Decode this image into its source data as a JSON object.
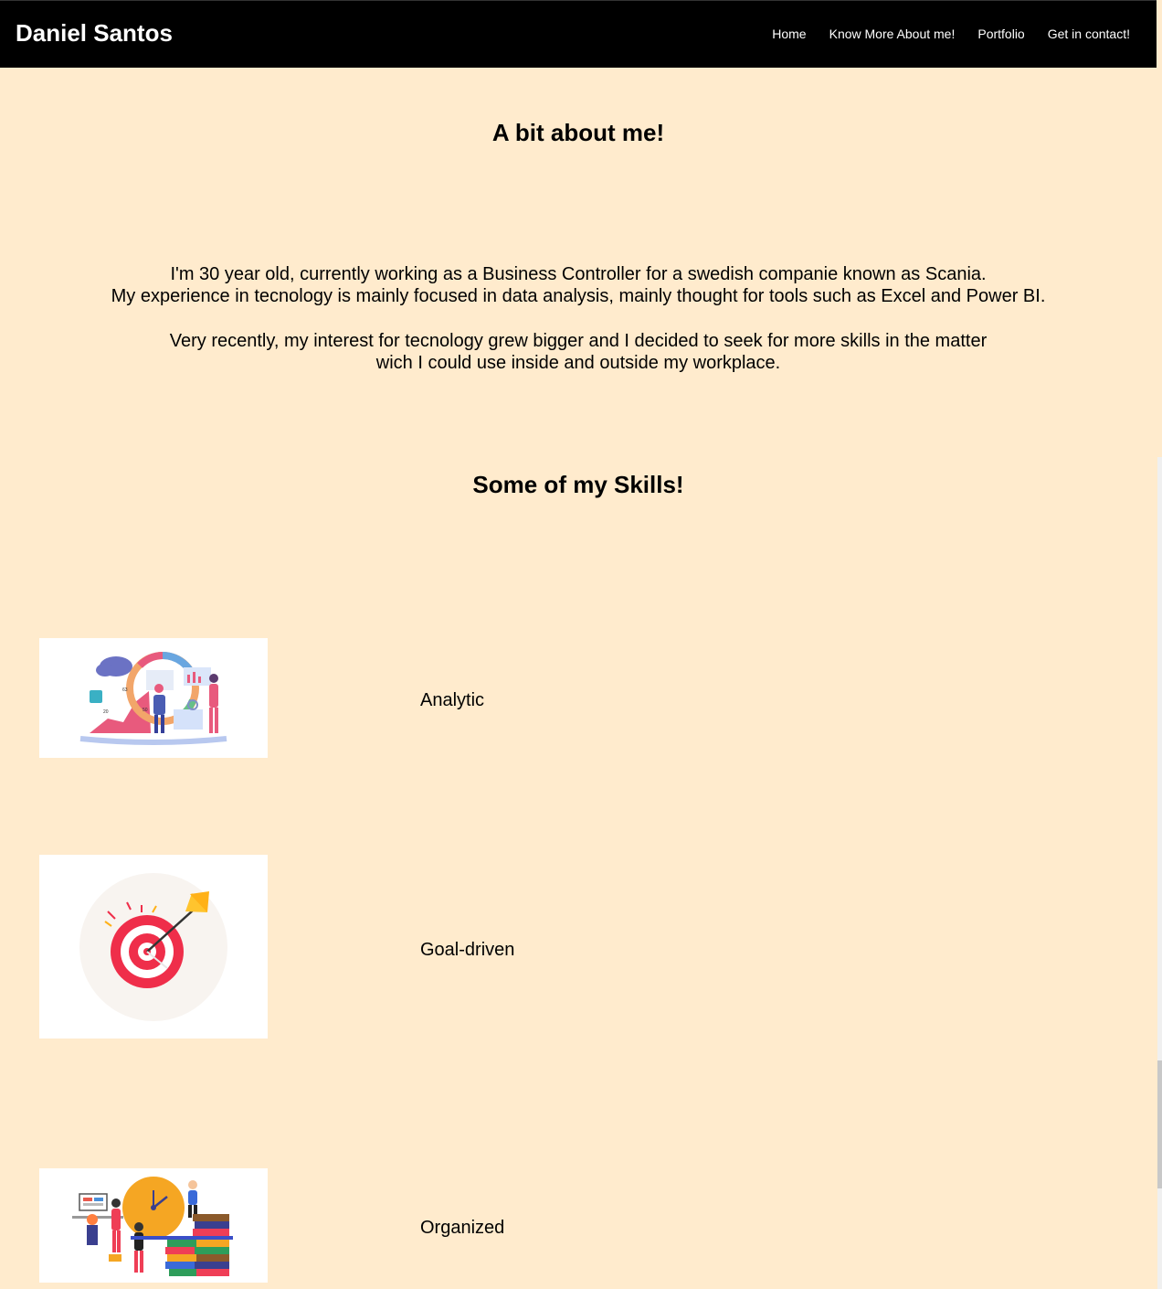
{
  "header": {
    "brand": "Daniel Santos",
    "nav": [
      "Home",
      "Know More About me!",
      "Portfolio",
      "Get in contact!"
    ]
  },
  "about": {
    "title": "A bit about me!",
    "para1_line1": "I'm 30 year old, currently working as a Business Controller for a swedish companie known as Scania.",
    "para1_line2": "My experience in tecnology is mainly focused in data analysis, mainly thought for tools such as Excel and Power BI.",
    "para2_line1": "Very recently, my interest for tecnology grew bigger and I decided to seek for more skills in the matter",
    "para2_line2": "wich I could use inside and outside my workplace."
  },
  "skills": {
    "title": "Some of my Skills!",
    "items": [
      {
        "label": "Analytic",
        "icon": "analytics-illustration"
      },
      {
        "label": "Goal-driven",
        "icon": "target-illustration"
      },
      {
        "label": "Organized",
        "icon": "organization-illustration"
      }
    ]
  },
  "colors": {
    "background": "#ffebcd",
    "header": "#000000"
  }
}
